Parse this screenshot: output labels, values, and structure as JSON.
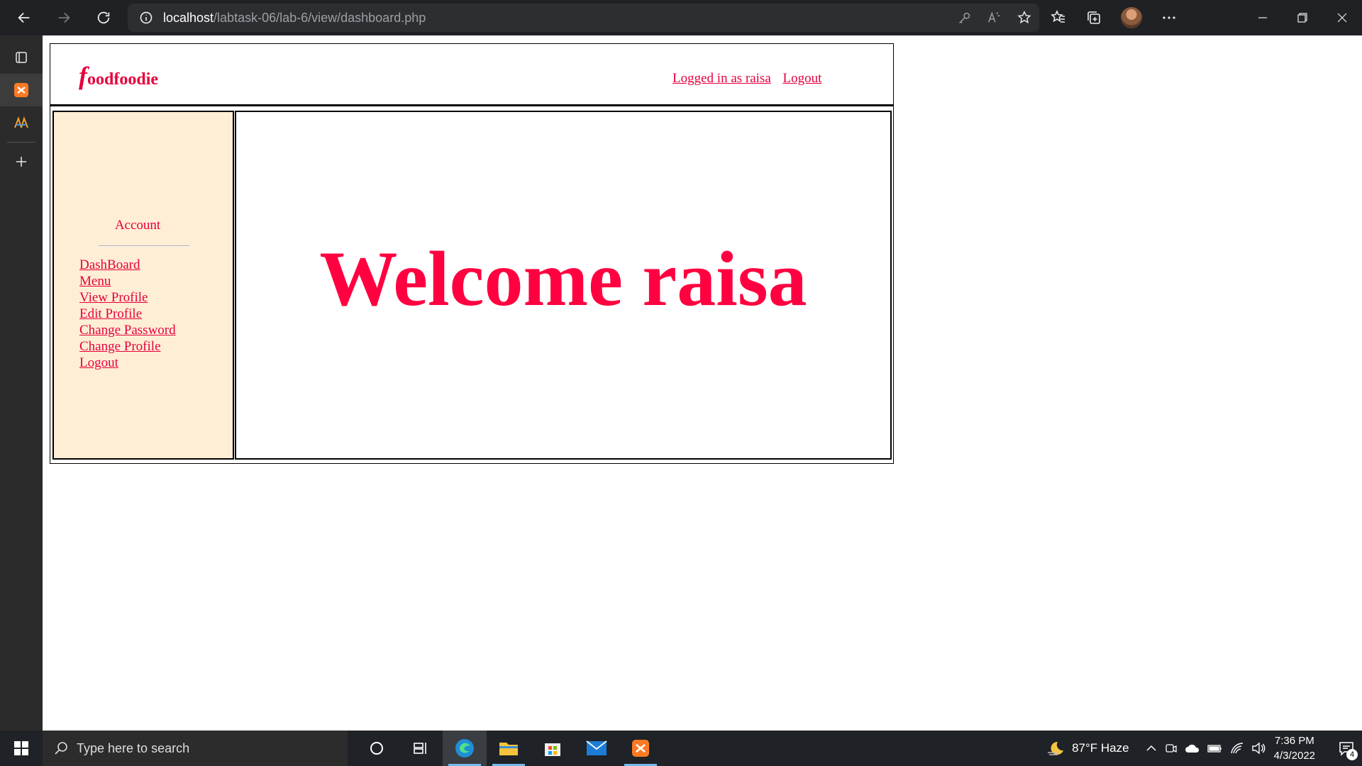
{
  "browser": {
    "url_host": "localhost",
    "url_path": "/labtask-06/lab-6/view/dashboard.php"
  },
  "header": {
    "logo_initial": "f",
    "logo_rest": "oodfoodie",
    "logged_in_label": "Logged in as raisa",
    "logout_label": "Logout"
  },
  "sidebar": {
    "title": "Account",
    "items": [
      {
        "label": "DashBoard"
      },
      {
        "label": "Menu"
      },
      {
        "label": "View Profile"
      },
      {
        "label": "Edit Profile"
      },
      {
        "label": "Change Password"
      },
      {
        "label": "Change Profile"
      },
      {
        "label": "Logout"
      }
    ]
  },
  "main": {
    "welcome": "Welcome raisa"
  },
  "taskbar": {
    "search_placeholder": "Type here to search",
    "weather": "87°F  Haze",
    "time": "7:36 PM",
    "date": "4/3/2022",
    "notification_count": "4"
  },
  "colors": {
    "accent": "#e6003c",
    "sidebar_bg": "#ffeed6"
  }
}
